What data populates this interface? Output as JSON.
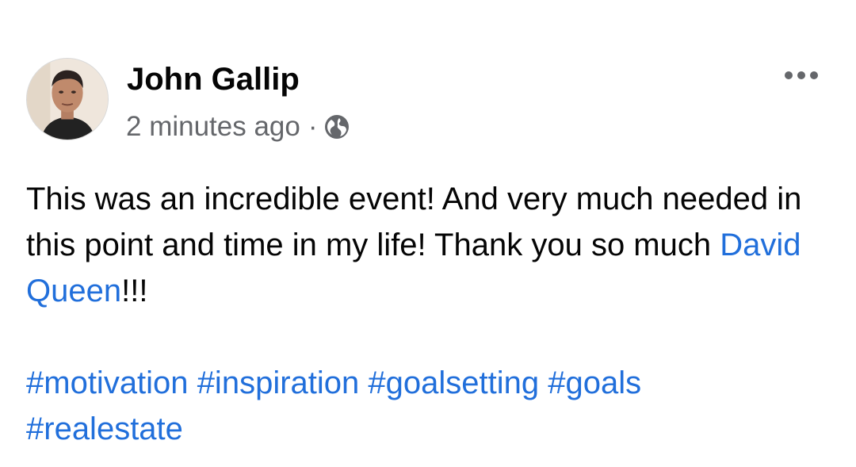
{
  "post": {
    "author": "John Gallip",
    "timestamp": "2 minutes ago",
    "separator": "·",
    "privacy_icon": "globe-icon",
    "more_icon": "more-options-icon",
    "body": {
      "part1": "This was an incredible event! And very much needed in this point and time in my life! Thank you so much ",
      "mention": "David Queen",
      "part2": "!!!"
    },
    "hashtags": [
      "#motivation",
      "#inspiration",
      "#goalsetting",
      "#goals",
      "#realestate"
    ]
  },
  "colors": {
    "text": "#050505",
    "secondary": "#65676b",
    "link": "#216fdb",
    "background": "#ffffff"
  }
}
